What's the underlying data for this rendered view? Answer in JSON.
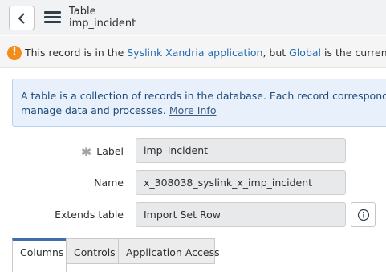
{
  "header": {
    "type_label": "Table",
    "record_name": "imp_incident"
  },
  "notice": {
    "prefix": "This record is in the ",
    "app_name": "Syslink Xandria",
    "app_word": " application",
    "middle": ", but ",
    "current_scope": "Global",
    "suffix": " is the current applicatio"
  },
  "info": {
    "line1": "A table is a collection of records in the database. Each record corresponds to a row in",
    "line2": "manage data and processes.",
    "more_link": "More Info",
    "colors": {
      "background": "#e8f1fb",
      "text": "#1d4a7a"
    }
  },
  "form": {
    "label": {
      "caption": "Label",
      "value": "imp_incident"
    },
    "name": {
      "caption": "Name",
      "value": "x_308038_syslink_x_imp_incident"
    },
    "extends": {
      "caption": "Extends table",
      "value": "Import Set Row",
      "info_icon": "info-circle-icon"
    }
  },
  "tabs": [
    {
      "label": "Columns",
      "active": true
    },
    {
      "label": "Controls",
      "active": false
    },
    {
      "label": "Application Access",
      "active": false
    }
  ],
  "colors": {
    "accent": "#3f6fa8",
    "warning": "#f08d1b",
    "link": "#1f6bb4"
  }
}
